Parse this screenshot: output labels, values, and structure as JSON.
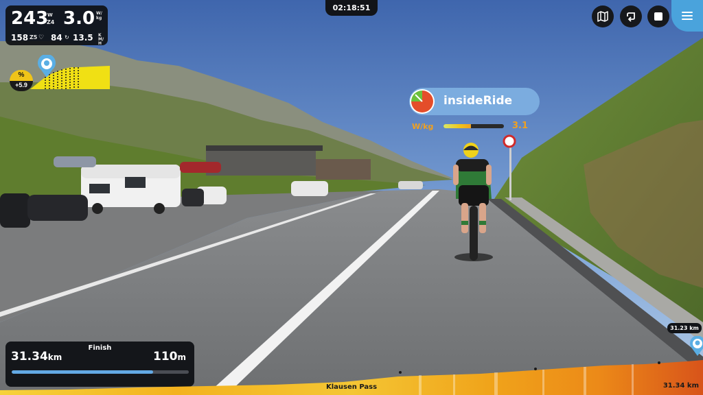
{
  "stats": {
    "power": "243",
    "power_unit_top": "W",
    "zone": "Z4",
    "wkg": "3.0",
    "wkg_unit": "W/kg",
    "heart_rate": "158",
    "hr_zone": "Z5",
    "cadence": "84",
    "speed": "13.5",
    "speed_unit": "KM/H"
  },
  "gradient": {
    "unit": "%",
    "value": "+5.9"
  },
  "timer": "02:18:51",
  "controls": {
    "map_icon": "map-icon",
    "replay_icon": "loop-icon",
    "stop_icon": "stop-icon",
    "menu_icon": "hamburger-menu-icon"
  },
  "rider": {
    "name": "insideRide",
    "wkg_label": "W/kg",
    "wkg_value": "3.1",
    "wkg_fraction": 0.45
  },
  "progress": {
    "marker_distance": "31.23 km",
    "finish_label": "Finish",
    "distance_value": "31.34",
    "distance_unit": "km",
    "remaining_value": "110",
    "remaining_unit": "m",
    "fraction": 0.8
  },
  "route": {
    "name": "Klausen Pass",
    "total_distance": "31.34 km"
  },
  "colors": {
    "accent_blue": "#4aa3dc",
    "grade_yellow": "#f0c419",
    "wkg_orange": "#f0a020"
  }
}
